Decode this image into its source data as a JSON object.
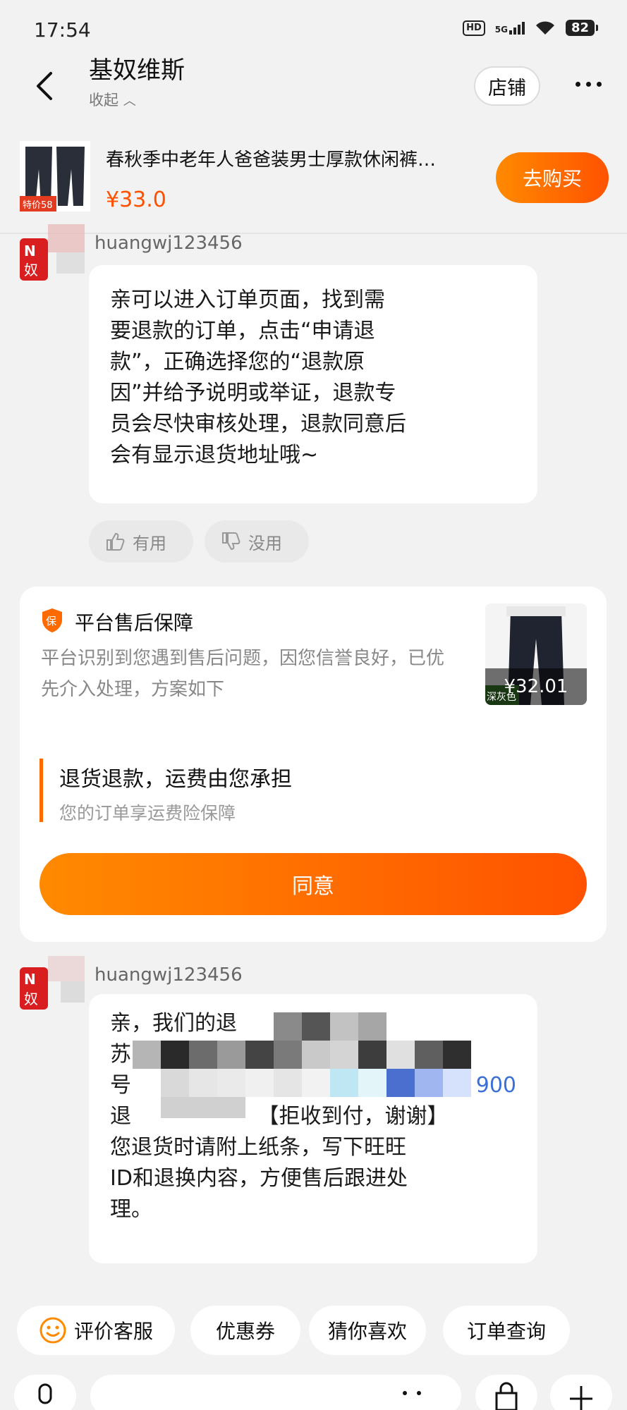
{
  "status_bar": {
    "time": "17:54",
    "hd": "HD",
    "network": "5G",
    "battery": "82"
  },
  "header": {
    "shop_name": "基奴维斯",
    "collapse_label": "收起",
    "store_button": "店铺"
  },
  "product": {
    "name": "春秋季中老年人爸爸装男士厚款休闲裤…",
    "price": "¥33.0",
    "buy_button": "去购买",
    "thumb_badge": "特价58"
  },
  "messages": [
    {
      "sender": "huangwj123456",
      "avatar_text": "N\n奴",
      "lines": [
        "亲可以进入订单页面，找到需",
        "要退款的订单，点击“申请退",
        "款”，正确选择您的“退款原",
        "因”并给予说明或举证，退款专",
        "员会尽快审核处理，退款同意后",
        "会有显示退货地址哦~"
      ]
    },
    {
      "sender": "huangwj123456",
      "avatar_text": "N\n奴",
      "lines": [
        "亲，我们的退",
        "苏",
        "号",
        "退",
        "您退货时请附上纸条，写下旺旺",
        "ID和退换内容，方便售后跟进处",
        "理。"
      ],
      "tail_number": "900",
      "reject_note": "【拒收到付，谢谢】"
    }
  ],
  "feedback": {
    "useful": "有用",
    "useless": "没用"
  },
  "aftersale_card": {
    "title": "平台售后保障",
    "desc": "平台识别到您遇到售后问题，因您信誉良好，已优先介入处理，方案如下",
    "item_price": "¥32.01",
    "item_tag": "深灰色",
    "plan_title": "退货退款，运费由您承担",
    "plan_sub": "您的订单享运费险保障",
    "agree_button": "同意"
  },
  "quick_actions": [
    "评价客服",
    "优惠券",
    "猜你喜欢",
    "订单查询"
  ],
  "colors": {
    "accent": "#ff5000",
    "accent_gradient_start": "#ff8a00",
    "background": "#f2f2f2"
  }
}
